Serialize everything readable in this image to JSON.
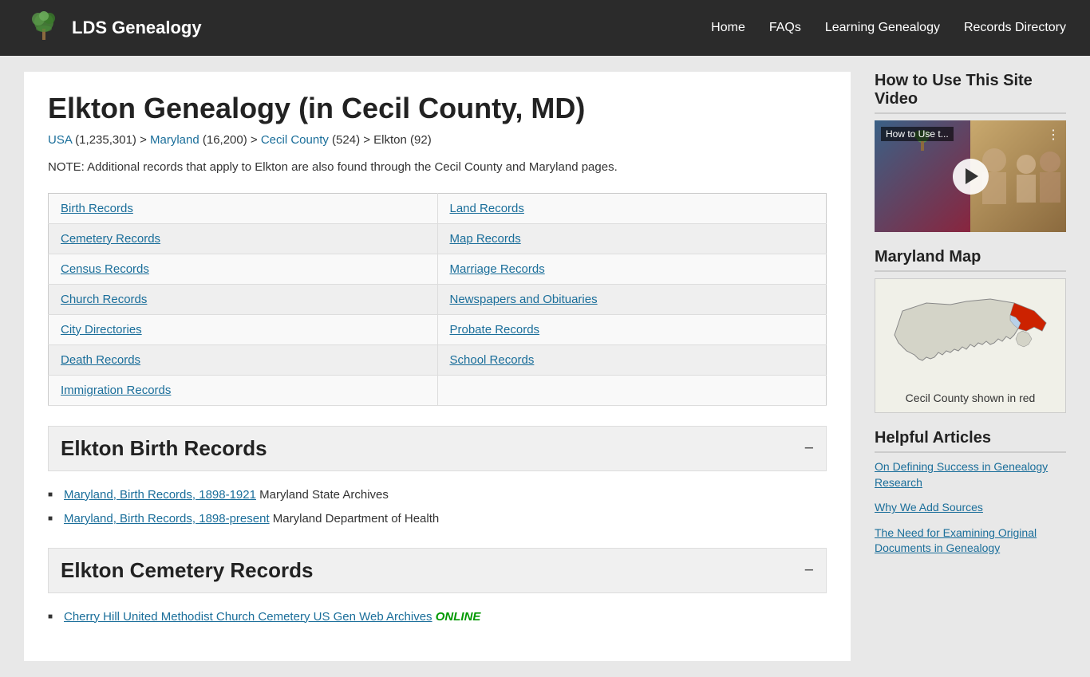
{
  "header": {
    "logo_text": "LDS Genealogy",
    "nav": [
      "Home",
      "FAQs",
      "Learning Genealogy",
      "Records Directory"
    ]
  },
  "main": {
    "page_title": "Elkton Genealogy (in Cecil County, MD)",
    "breadcrumb": {
      "usa_text": "USA",
      "usa_count": " (1,235,301) > ",
      "maryland_text": "Maryland",
      "maryland_count": " (16,200) > ",
      "county_text": "Cecil County",
      "county_count": " (524) > Elkton (92)"
    },
    "note": "NOTE: Additional records that apply to Elkton are also found through the Cecil County and Maryland pages.",
    "records": [
      [
        "Birth Records",
        "Land Records"
      ],
      [
        "Cemetery Records",
        "Map Records"
      ],
      [
        "Census Records",
        "Marriage Records"
      ],
      [
        "Church Records",
        "Newspapers and Obituaries"
      ],
      [
        "City Directories",
        "Probate Records"
      ],
      [
        "Death Records",
        "School Records"
      ],
      [
        "Immigration Records",
        ""
      ]
    ],
    "sections": [
      {
        "title": "Elkton Birth Records",
        "items": [
          {
            "link": "Maryland, Birth Records, 1898-1921",
            "text": " Maryland State Archives"
          },
          {
            "link": "Maryland, Birth Records, 1898-present",
            "text": " Maryland Department of Health"
          }
        ]
      },
      {
        "title": "Elkton Cemetery Records",
        "items": [
          {
            "link": "Cherry Hill United Methodist Church Cemetery US Gen Web Archives",
            "text": " ",
            "online": "ONLINE"
          }
        ]
      }
    ]
  },
  "sidebar": {
    "video_section": {
      "title": "How to Use This Site Video",
      "video_label": "How to Use t...",
      "dots": "⋮"
    },
    "map_section": {
      "title": "Maryland Map",
      "caption": "Cecil County shown in red"
    },
    "articles_section": {
      "title": "Helpful Articles",
      "articles": [
        "On Defining Success in Genealogy Research",
        "Why We Add Sources",
        "The Need for Examining Original Documents in Genealogy"
      ]
    }
  }
}
